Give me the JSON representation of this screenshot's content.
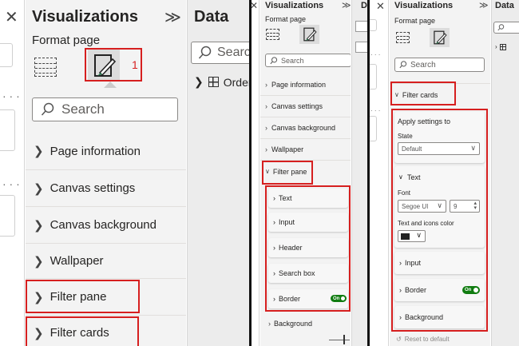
{
  "panel1": {
    "close_glyph": "✕",
    "title": "Visualizations",
    "collapse_glyph": "≫",
    "format_page": "Format page",
    "marker": "1",
    "search_placeholder": "Search",
    "items": [
      "Page information",
      "Canvas settings",
      "Canvas background",
      "Wallpaper",
      "Filter pane",
      "Filter cards"
    ],
    "data_title": "Data",
    "data_search": "Search",
    "data_tree_item": "Orders"
  },
  "panel2": {
    "close_glyph": "✕",
    "title": "Visualizations",
    "collapse_glyph": "≫",
    "data_title": "D",
    "format_page": "Format page",
    "search_placeholder": "Search",
    "items": [
      "Page information",
      "Canvas settings",
      "Canvas background",
      "Wallpaper"
    ],
    "expanded": "Filter pane",
    "sub_items": [
      "Text",
      "Input",
      "Header",
      "Search box",
      "Border",
      "Background"
    ],
    "toggle_label": "On"
  },
  "panel3": {
    "close_glyph": "✕",
    "title": "Visualizations",
    "collapse_glyph": "≫",
    "data_title": "Data",
    "format_page": "Format page",
    "search_placeholder": "Search",
    "expanded": "Filter cards",
    "apply_to": "Apply settings to",
    "state_label": "State",
    "state_value": "Default",
    "text_section": "Text",
    "font_label": "Font",
    "font_value": "Segoe UI",
    "font_size": "9",
    "text_color_label": "Text and icons color",
    "text_color": "#222222",
    "sub_items": [
      "Input",
      "Border",
      "Background"
    ],
    "toggle_label": "On",
    "reset": "Reset to default"
  }
}
